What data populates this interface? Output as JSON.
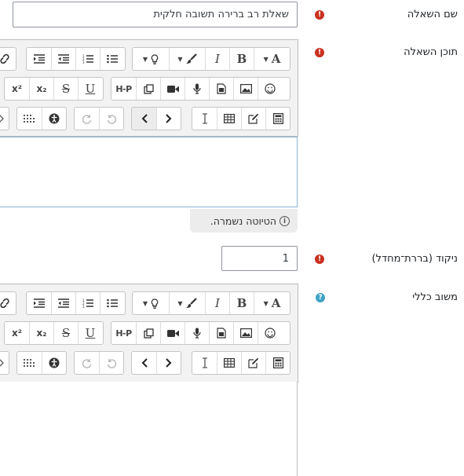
{
  "question_name": {
    "label": "שם השאלה",
    "value": "שאלת רב ברירה תשובה חלקית"
  },
  "question_text": {
    "label": "תוכן השאלה",
    "draft_status": "הטיוטה נשמרה."
  },
  "default_mark": {
    "label": "ניקוד (בררת־מחדל)",
    "value": "1"
  },
  "general_feedback": {
    "label": "משוב כללי"
  },
  "toolbar": {
    "font_label": "A",
    "bold_label": "B",
    "italic_label": "I",
    "underline_label": "U",
    "strike_label": "S",
    "subscript_label": "x₂",
    "superscript_label": "x²",
    "h5p_label": "H-P",
    "icons": [
      "font-icon",
      "paint-brush-icon",
      "lightbulb-icon",
      "bold-icon",
      "italic-icon",
      "bullet-list-icon",
      "numbered-list-icon",
      "outdent-icon",
      "indent-icon",
      "link-icon",
      "emoji-icon",
      "image-icon",
      "media-icon",
      "audio-icon",
      "video-icon",
      "copy-icon",
      "h5p-icon",
      "underline-icon",
      "strikethrough-icon",
      "subscript-icon",
      "superscript-icon",
      "calculator-icon",
      "edit-icon",
      "table-icon",
      "cursor-icon",
      "chevron-right-icon",
      "chevron-left-icon",
      "undo-icon",
      "redo-icon",
      "accessibility-icon",
      "more-icon"
    ]
  },
  "colors": {
    "required": "#ca3120",
    "help": "#3ea2c5",
    "toolbar_bg": "#f2f2f2"
  }
}
